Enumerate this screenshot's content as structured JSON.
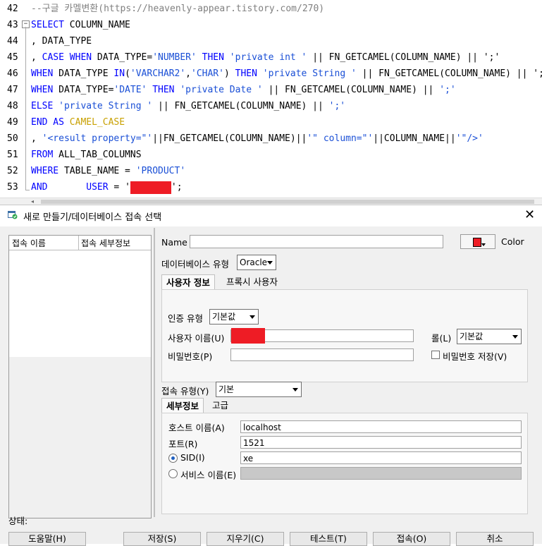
{
  "editor": {
    "lines": [
      {
        "n": "42",
        "code": [
          {
            "t": "--구글 카멜변환(https://heavenly-appear.tistory.com/270)",
            "c": "cmt"
          }
        ]
      },
      {
        "n": "43",
        "code": [
          {
            "t": "SELECT",
            "c": "kw"
          },
          {
            "t": " COLUMN_NAME",
            "c": ""
          }
        ]
      },
      {
        "n": "44",
        "code": [
          {
            "t": ", DATA_TYPE",
            "c": ""
          }
        ]
      },
      {
        "n": "45",
        "code": [
          {
            "t": ", ",
            "c": ""
          },
          {
            "t": "CASE WHEN",
            "c": "kw"
          },
          {
            "t": " DATA_TYPE=",
            "c": ""
          },
          {
            "t": "'NUMBER'",
            "c": "str"
          },
          {
            "t": " ",
            "c": ""
          },
          {
            "t": "THEN",
            "c": "kw"
          },
          {
            "t": " ",
            "c": ""
          },
          {
            "t": "'private int '",
            "c": "str"
          },
          {
            "t": " || FN_GETCAMEL(COLUMN_NAME) || ';'",
            "c": ""
          }
        ]
      },
      {
        "n": "46",
        "code": [
          {
            "t": "WHEN",
            "c": "kw"
          },
          {
            "t": " DATA_TYPE ",
            "c": ""
          },
          {
            "t": "IN",
            "c": "kw"
          },
          {
            "t": "(",
            "c": ""
          },
          {
            "t": "'VARCHAR2'",
            "c": "str"
          },
          {
            "t": ",",
            "c": ""
          },
          {
            "t": "'CHAR'",
            "c": "str"
          },
          {
            "t": ") ",
            "c": ""
          },
          {
            "t": "THEN",
            "c": "kw"
          },
          {
            "t": " ",
            "c": ""
          },
          {
            "t": "'private String '",
            "c": "str"
          },
          {
            "t": " || FN_GETCAMEL(COLUMN_NAME) || ';'",
            "c": ""
          }
        ]
      },
      {
        "n": "47",
        "code": [
          {
            "t": "WHEN",
            "c": "kw"
          },
          {
            "t": " DATA_TYPE=",
            "c": ""
          },
          {
            "t": "'DATE'",
            "c": "str"
          },
          {
            "t": " ",
            "c": ""
          },
          {
            "t": "THEN",
            "c": "kw"
          },
          {
            "t": " ",
            "c": ""
          },
          {
            "t": "'private Date '",
            "c": "str"
          },
          {
            "t": " || FN_GETCAMEL(COLUMN_NAME) || ",
            "c": ""
          },
          {
            "t": "';'",
            "c": "str"
          }
        ]
      },
      {
        "n": "48",
        "code": [
          {
            "t": "ELSE",
            "c": "kw"
          },
          {
            "t": " ",
            "c": ""
          },
          {
            "t": "'private String '",
            "c": "str"
          },
          {
            "t": " || FN_GETCAMEL(COLUMN_NAME) || ",
            "c": ""
          },
          {
            "t": "';'",
            "c": "str"
          }
        ]
      },
      {
        "n": "49",
        "code": [
          {
            "t": "END AS",
            "c": "kw"
          },
          {
            "t": " ",
            "c": ""
          },
          {
            "t": "CAMEL_CASE",
            "c": "ylw"
          }
        ]
      },
      {
        "n": "50",
        "code": [
          {
            "t": ", ",
            "c": ""
          },
          {
            "t": "'<result property=\"'",
            "c": "str"
          },
          {
            "t": "||FN_GETCAMEL(COLUMN_NAME)||",
            "c": ""
          },
          {
            "t": "'\" column=\"'",
            "c": "str"
          },
          {
            "t": "||COLUMN_NAME||",
            "c": ""
          },
          {
            "t": "'\"/>'",
            "c": "str"
          }
        ]
      },
      {
        "n": "51",
        "code": [
          {
            "t": "FROM",
            "c": "kw"
          },
          {
            "t": " ALL_TAB_COLUMNS",
            "c": ""
          }
        ]
      },
      {
        "n": "52",
        "code": [
          {
            "t": "WHERE",
            "c": "kw"
          },
          {
            "t": " TABLE_NAME = ",
            "c": ""
          },
          {
            "t": "'PRODUCT'",
            "c": "str"
          }
        ]
      },
      {
        "n": "53",
        "code": [
          {
            "t": "AND",
            "c": "kw"
          },
          {
            "t": "       ",
            "c": ""
          },
          {
            "t": "USER",
            "c": "kw"
          },
          {
            "t": " = '",
            "c": ""
          },
          {
            "t": "@@REDACT@@",
            "c": "redact"
          },
          {
            "t": "';",
            "c": ""
          }
        ]
      }
    ]
  },
  "dialog": {
    "title": "새로 만들기/데이터베이스 접속 선택",
    "left_panel": {
      "columns": [
        "접속 이름",
        "접속 세부정보"
      ]
    },
    "name_label": "Name",
    "name_value": "",
    "color_label": "Color",
    "color_value": "#ee1c25",
    "db_type_label": "데이터베이스 유형",
    "db_type_value": "Oracle",
    "tabs_top": [
      "사용자 정보",
      "프록시 사용자"
    ],
    "auth_type_label": "인증 유형",
    "auth_type_value": "기본값",
    "username_label": "사용자 이름(U)",
    "username_value": "",
    "role_label": "롤(L)",
    "role_value": "기본값",
    "password_label": "비밀번호(P)",
    "password_value": "",
    "save_password_label": "비밀번호 저장(V)",
    "conn_type_label": "접속 유형(Y)",
    "conn_type_value": "기본",
    "tabs_bottom": [
      "세부정보",
      "고급"
    ],
    "host_label": "호스트 이름(A)",
    "host_value": "localhost",
    "port_label": "포트(R)",
    "port_value": "1521",
    "sid_label": "SID(I)",
    "sid_value": "xe",
    "service_label": "서비스 이름(E)",
    "service_value": "",
    "status_label": "상태:",
    "buttons": {
      "help": "도움말(H)",
      "save": "저장(S)",
      "clear": "지우기(C)",
      "test": "테스트(T)",
      "connect": "접속(O)",
      "cancel": "취소"
    }
  }
}
